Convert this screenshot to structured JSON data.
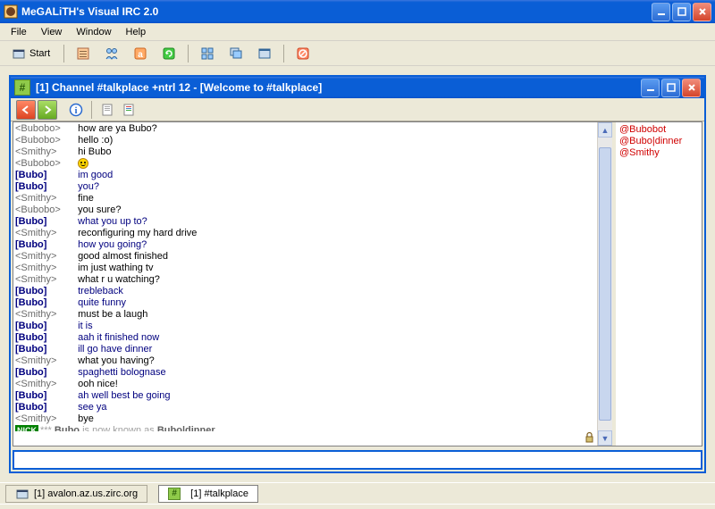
{
  "app": {
    "title": "MeGALiTH's Visual IRC 2.0"
  },
  "menus": [
    "File",
    "View",
    "Window",
    "Help"
  ],
  "toolbar": {
    "start": "Start"
  },
  "channel": {
    "title": "[1] Channel #talkplace +ntrl 12 - [Welcome to #talkplace]",
    "hash": "#"
  },
  "messages": [
    {
      "nick": "Bubobo",
      "style": "angle",
      "text": "how are ya Bubo?",
      "textColor": ""
    },
    {
      "nick": "Bubobo",
      "style": "angle",
      "text": "hello :o)",
      "textColor": ""
    },
    {
      "nick": "Smithy",
      "style": "angle",
      "text": "hi Bubo",
      "textColor": ""
    },
    {
      "nick": "Bubobo",
      "style": "angle",
      "text": "",
      "textColor": "",
      "smiley": true
    },
    {
      "nick": "Bubo",
      "style": "bold",
      "text": "im good",
      "textColor": "blue"
    },
    {
      "nick": "Bubo",
      "style": "bold",
      "text": "you?",
      "textColor": "blue"
    },
    {
      "nick": "Smithy",
      "style": "angle",
      "text": "fine",
      "textColor": ""
    },
    {
      "nick": "Bubobo",
      "style": "angle",
      "text": "you sure?",
      "textColor": ""
    },
    {
      "nick": "Bubo",
      "style": "bold",
      "text": "what you up to?",
      "textColor": "blue"
    },
    {
      "nick": "Smithy",
      "style": "angle",
      "text": "reconfiguring my hard drive",
      "textColor": ""
    },
    {
      "nick": "Bubo",
      "style": "bold",
      "text": "how you going?",
      "textColor": "blue"
    },
    {
      "nick": "Smithy",
      "style": "angle",
      "text": "good almost finished",
      "textColor": ""
    },
    {
      "nick": "Smithy",
      "style": "angle",
      "text": "im just wathing tv",
      "textColor": ""
    },
    {
      "nick": "Smithy",
      "style": "angle",
      "text": "what r u watching?",
      "textColor": ""
    },
    {
      "nick": "Bubo",
      "style": "bold",
      "text": "trebleback",
      "textColor": "blue"
    },
    {
      "nick": "Bubo",
      "style": "bold",
      "text": "quite funny",
      "textColor": "blue"
    },
    {
      "nick": "Smithy",
      "style": "angle",
      "text": "must be a laugh",
      "textColor": ""
    },
    {
      "nick": "Bubo",
      "style": "bold",
      "text": "it is",
      "textColor": "blue"
    },
    {
      "nick": "Bubo",
      "style": "bold",
      "text": "aah it finished now",
      "textColor": "blue"
    },
    {
      "nick": "Bubo",
      "style": "bold",
      "text": "ill go have dinner",
      "textColor": "blue"
    },
    {
      "nick": "Smithy",
      "style": "angle",
      "text": "what you having?",
      "textColor": ""
    },
    {
      "nick": "Bubo",
      "style": "bold",
      "text": "spaghetti bolognase",
      "textColor": "blue"
    },
    {
      "nick": "Smithy",
      "style": "angle",
      "text": "ooh nice!",
      "textColor": ""
    },
    {
      "nick": "Bubo",
      "style": "bold",
      "text": "ah well best be going",
      "textColor": "blue"
    },
    {
      "nick": "Bubo",
      "style": "bold",
      "text": "see ya",
      "textColor": "blue"
    },
    {
      "nick": "Smithy",
      "style": "angle",
      "text": "bye",
      "textColor": ""
    }
  ],
  "nickChange": {
    "badge": "NICK",
    "stars": "***",
    "old": "Bubo",
    "mid": " is now known as ",
    "new": "Bubo|dinner"
  },
  "nicklist": [
    "@Bubobot",
    "@Bubo|dinner",
    "@Smithy"
  ],
  "taskbar": {
    "server": "[1] avalon.az.us.zirc.org",
    "channel": "[1] #talkplace"
  }
}
